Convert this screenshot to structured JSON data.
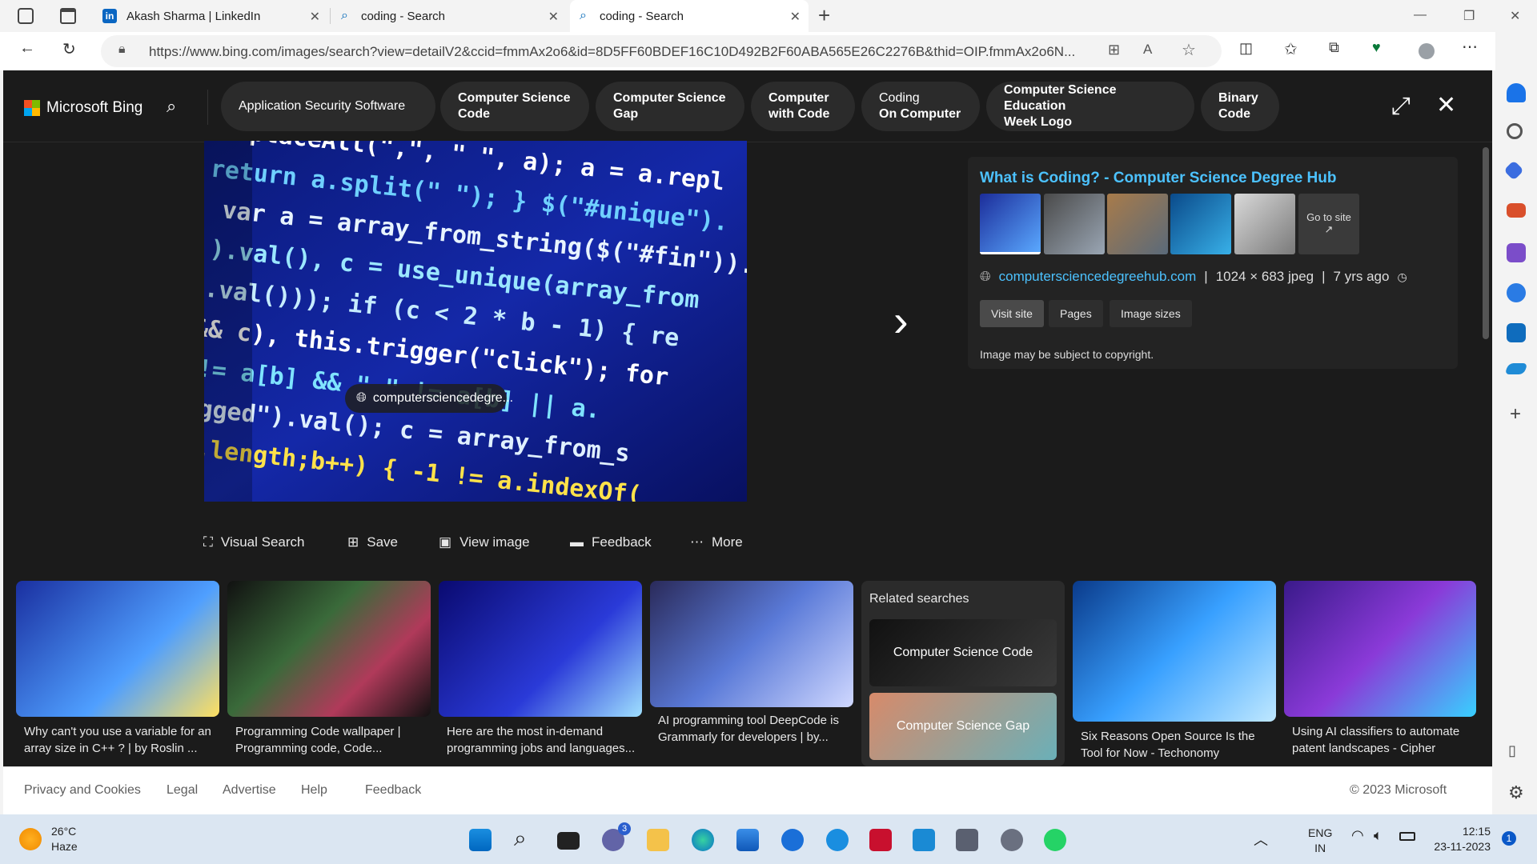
{
  "tabs": [
    {
      "title": "Akash Sharma | LinkedIn"
    },
    {
      "title": "coding - Search"
    },
    {
      "title": "coding - Search"
    }
  ],
  "address": {
    "url": "https://www.bing.com/images/search?view=detailV2&ccid=fmmAx2o6&id=8D5FF60BDEF16C10D492B2F60ABA565E26C2276B&thid=OIP.fmmAx2o6N..."
  },
  "bing": {
    "logo": "Microsoft Bing",
    "chips": [
      {
        "l1": "Application Security Software",
        "l2": ""
      },
      {
        "l1": "Computer Science",
        "l2": "Code"
      },
      {
        "l1": "Computer Science",
        "l2": "Gap"
      },
      {
        "l1": "Computer",
        "l2": "with Code"
      },
      {
        "l1": "Coding",
        "l2": "On Computer"
      },
      {
        "l1": "Computer Science Education",
        "l2": "Week Logo"
      },
      {
        "l1": "Binary",
        "l2": "Code"
      }
    ],
    "image_source_label": "computersciencedegre...",
    "info": {
      "title": "What is Coding? - Computer Science Degree Hub",
      "go_to_site": "Go to site",
      "domain": "computersciencedegreehub.com",
      "dimensions": "1024 × 683 jpeg",
      "age": "7 yrs ago",
      "buttons": [
        "Visit site",
        "Pages",
        "Image sizes"
      ],
      "copyright": "Image may be subject to copyright."
    },
    "actions": [
      "Visual Search",
      "Save",
      "View image",
      "Feedback",
      "More"
    ],
    "cards": [
      {
        "text": "Why can't you use a variable for an array size in C++ ? | by Roslin ..."
      },
      {
        "text": "Programming Code wallpaper | Programming code, Code..."
      },
      {
        "text": "Here are the most in-demand programming jobs and languages..."
      },
      {
        "text": "AI programming tool DeepCode is Grammarly for developers | by..."
      },
      {
        "text": "Six Reasons Open Source Is the Tool for Now - Techonomy"
      },
      {
        "text": "Using AI classifiers to automate patent landscapes - Cipher"
      }
    ],
    "related": {
      "title": "Related searches",
      "items": [
        "Computer Science Code",
        "Computer Science Gap"
      ]
    },
    "footer": {
      "links": [
        "Privacy and Cookies",
        "Legal",
        "Advertise",
        "Help",
        "Feedback"
      ],
      "copyright": "© 2023 Microsoft"
    }
  },
  "taskbar": {
    "weather_temp": "26°C",
    "weather_desc": "Haze",
    "teams_badge": "3",
    "lang": "ENG",
    "region": "IN",
    "time": "12:15",
    "date": "23-11-2023",
    "notif_count": "1"
  }
}
